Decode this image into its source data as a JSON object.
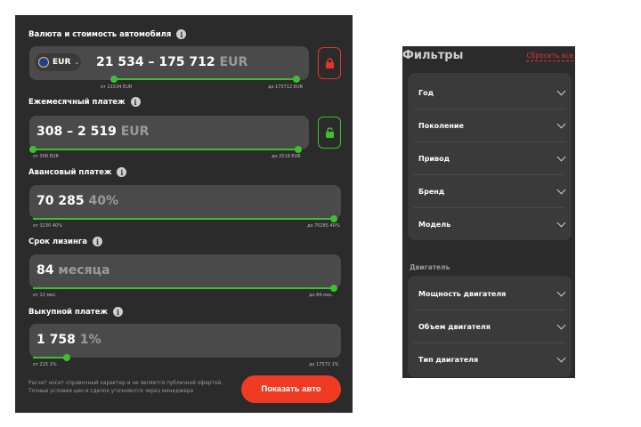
{
  "calculator": {
    "price": {
      "label": "Валюта и стоимость автомобиля",
      "currency": "EUR",
      "value": "21 534 – 175 712",
      "unit": "EUR",
      "min_label": "от 21534 EUR",
      "max_label": "до 175712 EUR",
      "lock": "locked"
    },
    "monthly": {
      "label": "Ежемесячный платеж",
      "value": "308 – 2 519",
      "unit": "EUR",
      "min_label": "от 308 EUR",
      "max_label": "до 2519 EUR",
      "lock": "unlocked"
    },
    "advance": {
      "label": "Авансовый платеж",
      "value": "70 285",
      "suffix": "40%",
      "min_label": "от 3230 40%",
      "max_label": "до 70285 40%",
      "fill_fraction": 1.0
    },
    "term": {
      "label": "Срок лизинга",
      "value": "84",
      "suffix": "месяца",
      "min_label": "от 12 мес.",
      "max_label": "до 84 мес.",
      "fill_fraction": 1.0
    },
    "buyout": {
      "label": "Выкупной платеж",
      "value": "1 758",
      "suffix": "1%",
      "min_label": "от 215 1%",
      "max_label": "до 17572 1%",
      "fill_fraction": 0.0
    },
    "disclaimer": "Расчет носит справочный характер и не является публичной офертой. Точные условия цен и сделок уточняются через менеджера",
    "cta_label": "Показать авто"
  },
  "filters": {
    "title": "Фильтры",
    "reset_label": "Сбросить все",
    "main_items": [
      "Год",
      "Поколение",
      "Привод",
      "Бренд",
      "Модель"
    ],
    "engine_group_title": "Двигатель",
    "engine_items": [
      "Мощность двигателя",
      "Объем двигателя",
      "Тип двигателя"
    ]
  },
  "colors": {
    "accent_green": "#3fbf2f",
    "accent_red": "#ef3b24",
    "panel_bg": "#2b2b2b",
    "field_bg": "#4a4a4a"
  }
}
